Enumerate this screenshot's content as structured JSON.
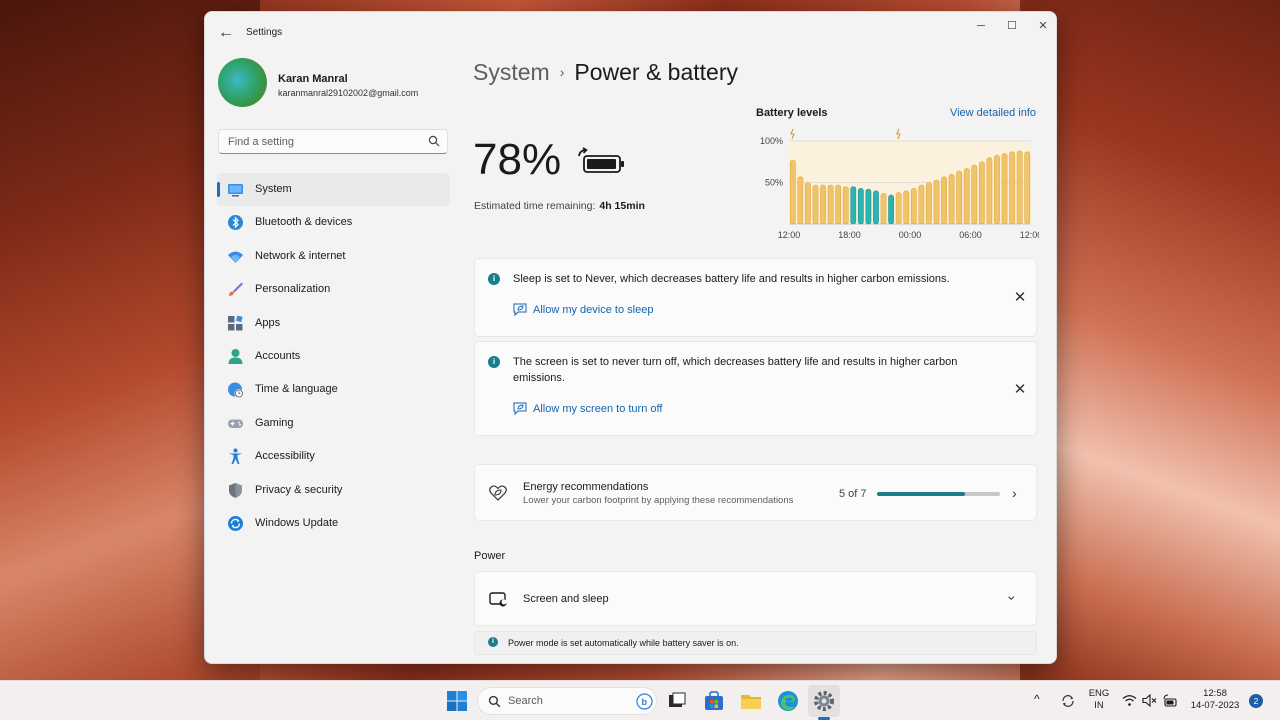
{
  "window": {
    "app_title": "Settings"
  },
  "profile": {
    "name": "Karan Manral",
    "email": "karanmanral29102002@gmail.com"
  },
  "search": {
    "placeholder": "Find a setting"
  },
  "sidebar": {
    "items": [
      {
        "label": "System",
        "icon": "system-icon",
        "active": true
      },
      {
        "label": "Bluetooth & devices",
        "icon": "bluetooth-icon"
      },
      {
        "label": "Network & internet",
        "icon": "wifi-icon"
      },
      {
        "label": "Personalization",
        "icon": "brush-icon"
      },
      {
        "label": "Apps",
        "icon": "apps-icon"
      },
      {
        "label": "Accounts",
        "icon": "person-icon"
      },
      {
        "label": "Time & language",
        "icon": "globe-clock-icon"
      },
      {
        "label": "Gaming",
        "icon": "gamepad-icon"
      },
      {
        "label": "Accessibility",
        "icon": "accessibility-icon"
      },
      {
        "label": "Privacy & security",
        "icon": "shield-icon"
      },
      {
        "label": "Windows Update",
        "icon": "update-icon"
      }
    ]
  },
  "main": {
    "breadcrumb_parent": "System",
    "breadcrumb_sep": "›",
    "breadcrumb_current": "Power & battery",
    "battery_percent": "78%",
    "time_remaining_label": "Estimated time remaining:",
    "time_remaining_value": "4h 15min",
    "battery_levels_title": "Battery levels",
    "view_detailed_info": "View detailed info",
    "notices": [
      {
        "text": "Sleep is set to Never, which decreases battery life and results in higher carbon emissions.",
        "link": "Allow my device to sleep"
      },
      {
        "text": "The screen is set to never turn off, which decreases battery life and results in higher carbon emissions.",
        "link": "Allow my screen to turn off"
      }
    ],
    "energy": {
      "title": "Energy recommendations",
      "subtitle": "Lower your carbon footprint by applying these recommendations",
      "progress_text": "5 of 7",
      "progress_fraction": 0.714
    },
    "power_section": "Power",
    "screen_and_sleep": "Screen and sleep",
    "power_mode_note": "Power mode is set automatically while battery saver is on."
  },
  "chart_data": {
    "type": "bar",
    "title": "Battery levels",
    "ytick_labels": [
      "100%",
      "50%"
    ],
    "xtick_labels": [
      "12:00",
      "18:00",
      "00:00",
      "06:00",
      "12:00"
    ],
    "ylim": [
      0,
      100
    ],
    "values": [
      77,
      57,
      50,
      47,
      47,
      47,
      47,
      45,
      45,
      43,
      42,
      40,
      37,
      35,
      38,
      40,
      43,
      47,
      50,
      53,
      57,
      60,
      64,
      67,
      71,
      75,
      80,
      83,
      85,
      87,
      88,
      87
    ],
    "saver_indices": [
      8,
      9,
      10,
      11,
      13
    ],
    "colors": {
      "normal": "#f2c46a",
      "normal_stroke": "#e0a93e",
      "saver": "#2db3b0",
      "saver_stroke": "#1f9693",
      "charging_band": "#fbf1dc"
    },
    "charging_bands": [
      [
        0,
        13
      ],
      [
        14,
        31
      ]
    ]
  },
  "taskbar": {
    "search_label": "Search",
    "language_top": "ENG",
    "language_bottom": "IN",
    "time": "12:58",
    "date": "14-07-2023",
    "notification_count": "2"
  }
}
